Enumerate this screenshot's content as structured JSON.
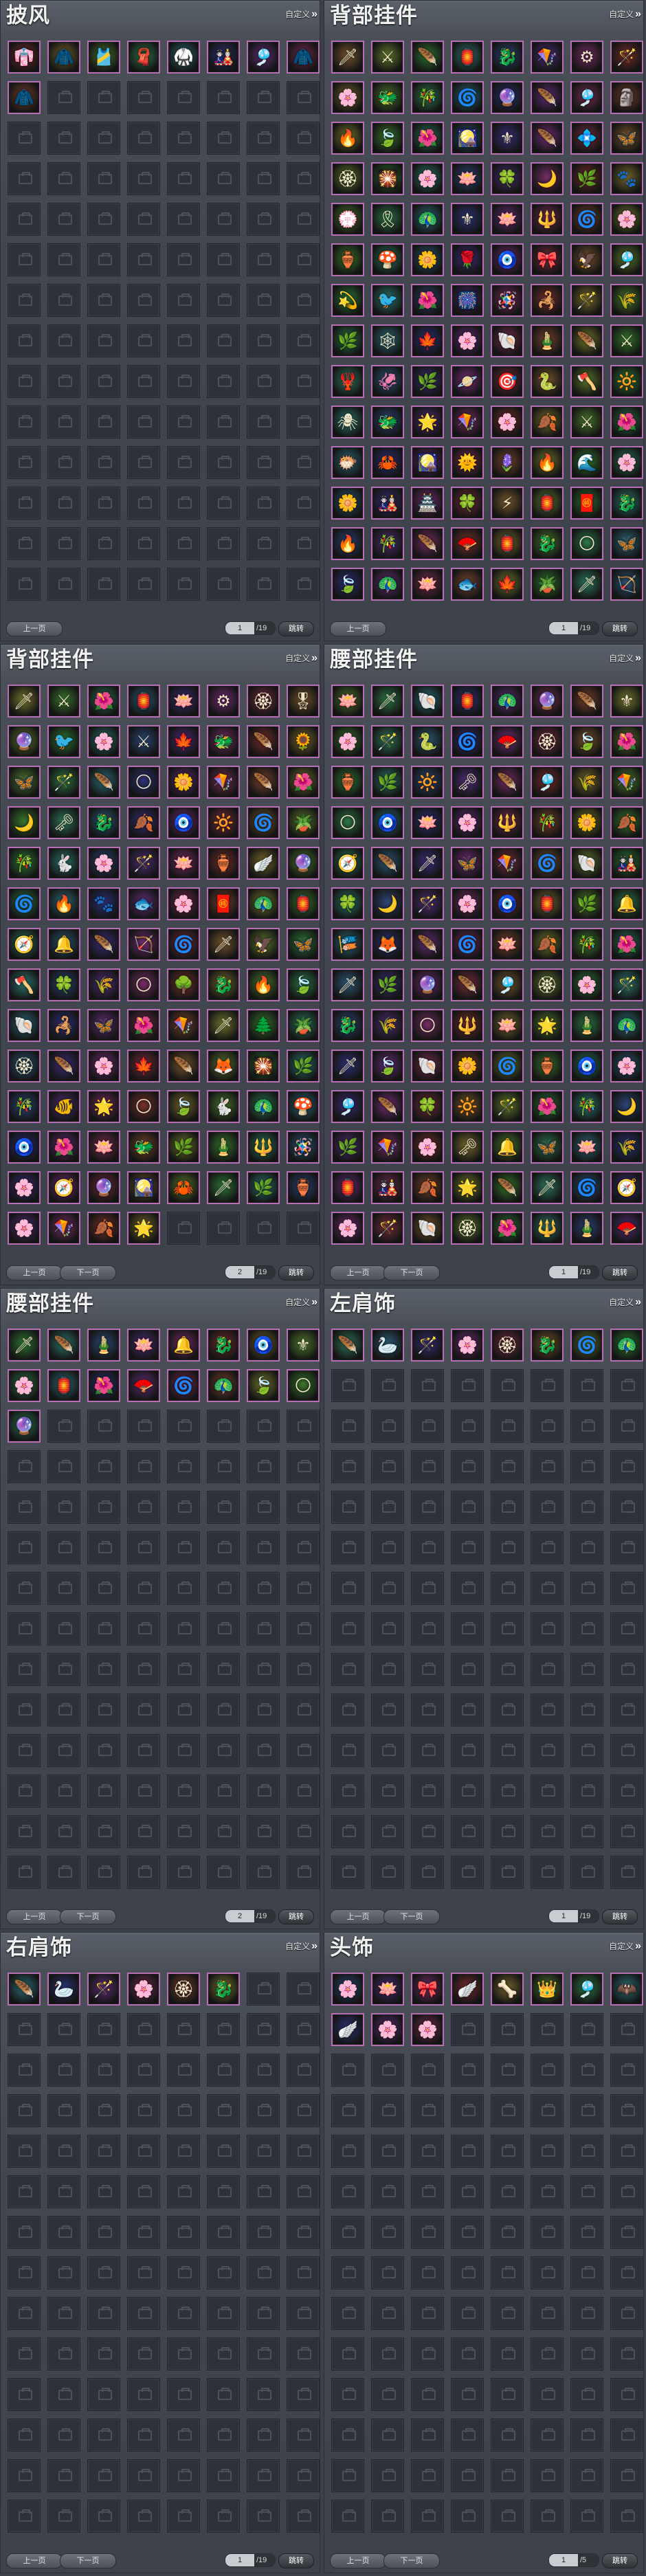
{
  "labels": {
    "custom": "自定义",
    "prev": "上一页",
    "next": "下一页",
    "jump": "跳转"
  },
  "colors": {
    "panel_bg": "#42464e",
    "slot_empty": "#2e3137",
    "item_border": "#b66fb5"
  },
  "panels": [
    {
      "title": "披风",
      "page": "1",
      "total": "/19",
      "next_enabled": false,
      "items": [
        "👘",
        "🧥",
        "🎽",
        "🧣",
        "🥋",
        "🎎",
        "🎐",
        "🧥",
        "🧥"
      ]
    },
    {
      "title": "背部挂件",
      "page": "1",
      "total": "/19",
      "next_enabled": false,
      "items": [
        "🗡",
        "⚔",
        "🪶",
        "🏮",
        "🐉",
        "🪁",
        "⚙",
        "🪄",
        "🌸",
        "🐲",
        "🎋",
        "🌀",
        "🔮",
        "🪶",
        "🎐",
        "🗿",
        "🔥",
        "🍃",
        "🌺",
        "🎑",
        "⚜",
        "🪶",
        "💠",
        "🦋",
        "🏵",
        "🎇",
        "🌸",
        "🪷",
        "🍀",
        "🌙",
        "🌿",
        "🐾",
        "💮",
        "🎗",
        "🦚",
        "⚜",
        "🪷",
        "🔱",
        "🌀",
        "🌸",
        "🏺",
        "🍄",
        "🌼",
        "🌹",
        "🧿",
        "🎀",
        "🦅",
        "🎐",
        "💫",
        "🐦",
        "🌺",
        "🎆",
        "🪅",
        "🦂",
        "🪄",
        "🌾",
        "🌿",
        "🕸",
        "🍁",
        "🌸",
        "🐚",
        "🎍",
        "🪶",
        "⚔",
        "🦞",
        "🦑",
        "🌿",
        "🪐",
        "🎯",
        "🐍",
        "🪓",
        "🔆",
        "🕷",
        "🐲",
        "🌟",
        "🪁",
        "🌸",
        "🍂",
        "⚔",
        "🌺",
        "🐡",
        "🦀",
        "🎑",
        "🌞",
        "🪻",
        "🔥",
        "🌊",
        "🌸",
        "🌼",
        "🎎",
        "🏯",
        "🍀",
        "⚡",
        "🏮",
        "🧧",
        "🐉",
        "🔥",
        "🎋",
        "🪶",
        "🪭",
        "🏮",
        "🐉",
        "🌕",
        "🦋",
        "🍃",
        "🦚",
        "🪷",
        "🐟",
        "🍁",
        "🪴",
        "🗡",
        "🏹",
        "🌻",
        "⚜",
        "🐇",
        "🎃",
        "🔰",
        "🏵",
        "🗡",
        "🎐",
        "⭐",
        "🍂",
        "🦚",
        "🎋",
        "🔆",
        "🧧",
        "🪄",
        "🌿",
        "🍀",
        "🌿",
        "🏺",
        "🎇"
      ]
    },
    {
      "title": "背部挂件",
      "page": "2",
      "total": "/19",
      "next_enabled": false,
      "items": [
        "🗡",
        "⚔",
        "🌺",
        "🏮",
        "🪷",
        "⚙",
        "🏵",
        "🎖",
        "🔮",
        "🐦",
        "🌸",
        "⚔",
        "🍁",
        "🐲",
        "🪶",
        "🌻",
        "🦋",
        "🪄",
        "🪶",
        "🌕",
        "🌼",
        "🪁",
        "🪶",
        "🌺",
        "🌙",
        "🗝",
        "🐉",
        "🍂",
        "🧿",
        "🔆",
        "🌀",
        "🪴",
        "🎋",
        "🐇",
        "🌸",
        "🪄",
        "🪷",
        "🏺",
        "🪽",
        "🔮",
        "🌀",
        "🔥",
        "🐾",
        "🐟",
        "🌸",
        "🧧",
        "🦚",
        "🏮",
        "🧭",
        "🔔",
        "🪶",
        "🏹",
        "🌀",
        "🗡",
        "🦅",
        "🦋",
        "🪓",
        "🍀",
        "🌾",
        "🌕",
        "🌳",
        "🐉",
        "🔥",
        "🍃",
        "🐚",
        "🦂",
        "🦋",
        "🌺",
        "🪁",
        "🗡",
        "🌲",
        "🪴",
        "🏵",
        "🪶",
        "🌸",
        "🍁",
        "🪶",
        "🦊",
        "🎇",
        "🌿",
        "🎋",
        "🐠",
        "🌟",
        "🌕",
        "🍃",
        "🐇",
        "🦚",
        "🍄",
        "🧿",
        "🌺",
        "🪷",
        "🐲",
        "🌿",
        "🎍",
        "🔱",
        "🪅",
        "🌸",
        "🧭",
        "🔮",
        "🎑",
        "🦀",
        "🗡",
        "🌿",
        "🏺",
        "🌸",
        "🪁",
        "🍂",
        "🌟"
      ]
    },
    {
      "title": "腰部挂件",
      "page": "1",
      "total": "/19",
      "next_enabled": false,
      "items": [
        "🪷",
        "🗡",
        "🐚",
        "🏮",
        "🦚",
        "🔮",
        "🪶",
        "⚜",
        "🌸",
        "🪄",
        "🐍",
        "🌀",
        "🪭",
        "🏵",
        "🍃",
        "🌺",
        "🏺",
        "🌿",
        "🔆",
        "🗝",
        "🪶",
        "🎐",
        "🌾",
        "🪁",
        "🌕",
        "🧿",
        "🪷",
        "🌸",
        "🔱",
        "🎋",
        "🌼",
        "🍂",
        "🧭",
        "🪶",
        "🗡",
        "🦋",
        "🪁",
        "🌀",
        "🐚",
        "🎎",
        "🍀",
        "🌙",
        "🪄",
        "🌸",
        "🧿",
        "🏮",
        "🌿",
        "🔔",
        "🎏",
        "🦊",
        "🪶",
        "🌀",
        "🪷",
        "🍂",
        "🎋",
        "🌺",
        "🗡",
        "🌿",
        "🔮",
        "🪶",
        "🎐",
        "🏵",
        "🌸",
        "🪄",
        "🐉",
        "🌾",
        "🌕",
        "🔱",
        "🪷",
        "🌟",
        "🎍",
        "🦚",
        "🗡",
        "🍃",
        "🐚",
        "🌼",
        "🌀",
        "🏺",
        "🧿",
        "🌸",
        "🎐",
        "🪶",
        "🍀",
        "🔆",
        "🪄",
        "🌺",
        "🎋",
        "🌙",
        "🌿",
        "🪁",
        "🌸",
        "🗝",
        "🔔",
        "🦋",
        "🪷",
        "🌾",
        "🏮",
        "🎎",
        "🍂",
        "🌟",
        "🪶",
        "🗡",
        "🌀",
        "🧭",
        "🌸",
        "🪄",
        "🐚",
        "🏵",
        "🌺",
        "🔱",
        "🎍",
        "🪭",
        "🌕",
        "🍁",
        "🦚",
        "🌿",
        "🪷",
        "🐉",
        "🔮",
        "🌸",
        "🪁",
        "🗡",
        "🍃",
        "🌼",
        "🏮",
        "🎐",
        "🐇",
        "🌀",
        "🔆",
        "🪶",
        "🌿",
        "🧿",
        "🌸",
        "🪄",
        "🔱",
        "🌾",
        "🎋",
        "🏺",
        "🪷",
        "🌟"
      ]
    },
    {
      "title": "腰部挂件",
      "page": "2",
      "total": "/19",
      "next_enabled": false,
      "items": [
        "🗡",
        "🪶",
        "🎍",
        "🪷",
        "🔔",
        "🐉",
        "🧿",
        "⚜",
        "🌸",
        "🏮",
        "🌺",
        "🪭",
        "🌀",
        "🦚",
        "🍃",
        "🌕",
        "🔮"
      ]
    },
    {
      "title": "左肩饰",
      "page": "1",
      "total": "/19",
      "next_enabled": false,
      "items": [
        "🪶",
        "🦢",
        "🪄",
        "🌸",
        "🏵",
        "🐉",
        "🌀",
        "🦚"
      ]
    },
    {
      "title": "右肩饰",
      "page": "1",
      "total": "/19",
      "next_enabled": false,
      "items": [
        "🪶",
        "🦢",
        "🪄",
        "🌸",
        "🏵",
        "🐉"
      ]
    },
    {
      "title": "头饰",
      "page": "1",
      "total": "/5",
      "next_enabled": false,
      "items": [
        "🌸",
        "🪷",
        "🎀",
        "🪽",
        "🦴",
        "👑",
        "🎐",
        "🦇",
        "🪽",
        "🌸",
        "🌸"
      ]
    }
  ]
}
